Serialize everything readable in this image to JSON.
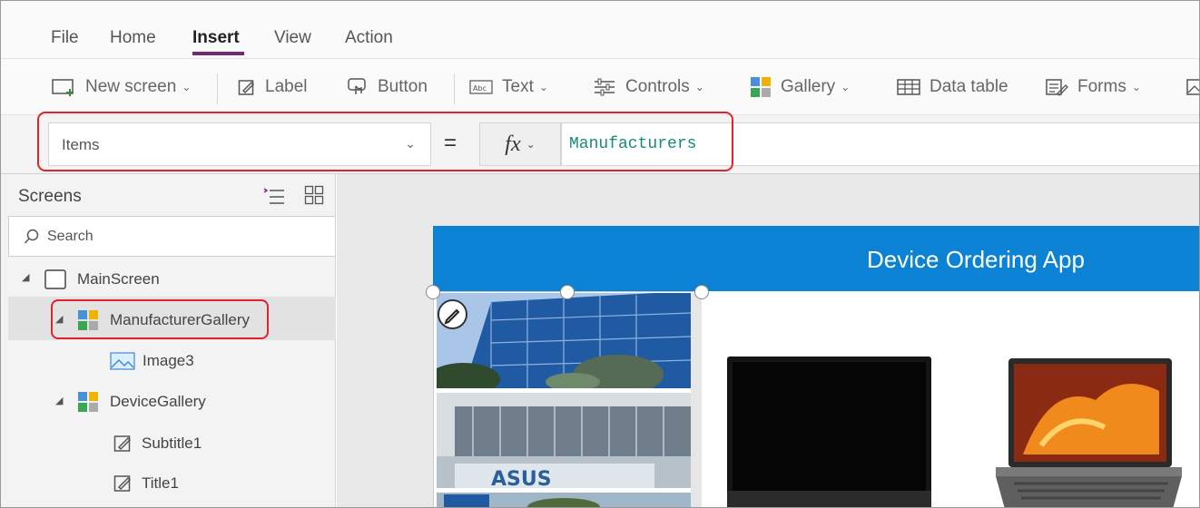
{
  "menu": {
    "file": "File",
    "home": "Home",
    "insert": "Insert",
    "view": "View",
    "action": "Action"
  },
  "ribbon": {
    "new_screen": "New screen",
    "label": "Label",
    "button": "Button",
    "text": "Text",
    "controls": "Controls",
    "gallery": "Gallery",
    "data_table": "Data table",
    "forms": "Forms"
  },
  "formula": {
    "property": "Items",
    "equals": "=",
    "fx": "fx",
    "value": "Manufacturers"
  },
  "panel": {
    "title": "Screens",
    "search_placeholder": "Search",
    "tree": {
      "main_screen": "MainScreen",
      "manufacturer_gallery": "ManufacturerGallery",
      "image3": "Image3",
      "device_gallery": "DeviceGallery",
      "subtitle1": "Subtitle1",
      "title1": "Title1"
    }
  },
  "app": {
    "title": "Device Ordering App",
    "header_color": "#0c82d4"
  },
  "colors": {
    "accent": "#742774",
    "highlight": "#e0242a",
    "formula_text": "#1a8a7a"
  }
}
